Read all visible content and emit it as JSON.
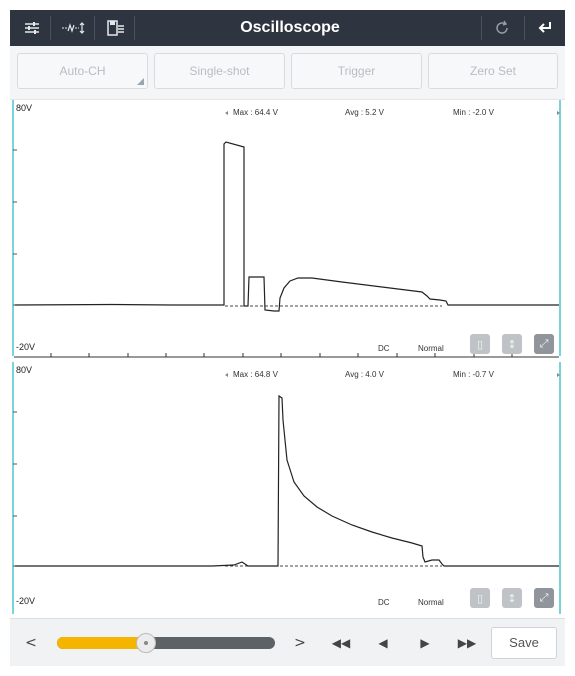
{
  "header": {
    "title": "Oscilloscope",
    "icons": [
      "sliders-icon",
      "measure-icon",
      "save-list-icon",
      "refresh-icon",
      "back-icon"
    ]
  },
  "toolbar": {
    "buttons": [
      {
        "label": "Auto-CH"
      },
      {
        "label": "Single-shot"
      },
      {
        "label": "Trigger"
      },
      {
        "label": "Zero Set"
      }
    ]
  },
  "channels": [
    {
      "max_label": "80V",
      "min_label": "-20V",
      "stats": {
        "max": "Max : 64.4 V",
        "avg": "Avg : 5.2 V",
        "min": "Min : -2.0 V"
      },
      "coupling": "DC",
      "mode": "Normal"
    },
    {
      "max_label": "80V",
      "min_label": "-20V",
      "stats": {
        "max": "Max : 64.8 V",
        "avg": "Avg : 4.0 V",
        "min": "Min : -0.7 V"
      },
      "coupling": "DC",
      "mode": "Normal"
    }
  ],
  "colors": {
    "titlebar": "#2e3540",
    "accent": "#4fc3d0",
    "slider_fill": "#f4b400",
    "trace": "#222222"
  },
  "bottom": {
    "slider_position": 0.41,
    "save_label": "Save"
  }
}
